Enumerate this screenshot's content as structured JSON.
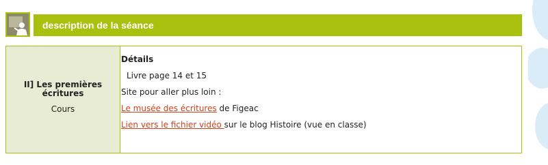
{
  "header": {
    "icon": "teacher-board-icon",
    "title": "description de la séance"
  },
  "session": {
    "title": "II] Les premières écritures",
    "type": "Cours"
  },
  "details": {
    "heading": "Détails",
    "book": "Livre page 14 et 15",
    "more_intro": "Site pour aller plus loin :",
    "link1": {
      "text": "Le musée des écritures",
      "after": " de Figeac"
    },
    "link2": {
      "text": "Lien vers le fichier vidéo ",
      "after": "sur le blog Histoire (vue en classe)"
    }
  },
  "colors": {
    "accent": "#a9c00f",
    "left_cell_bg": "#e8ecd5",
    "link": "#d0401a",
    "deco": "#d9ecf7"
  }
}
